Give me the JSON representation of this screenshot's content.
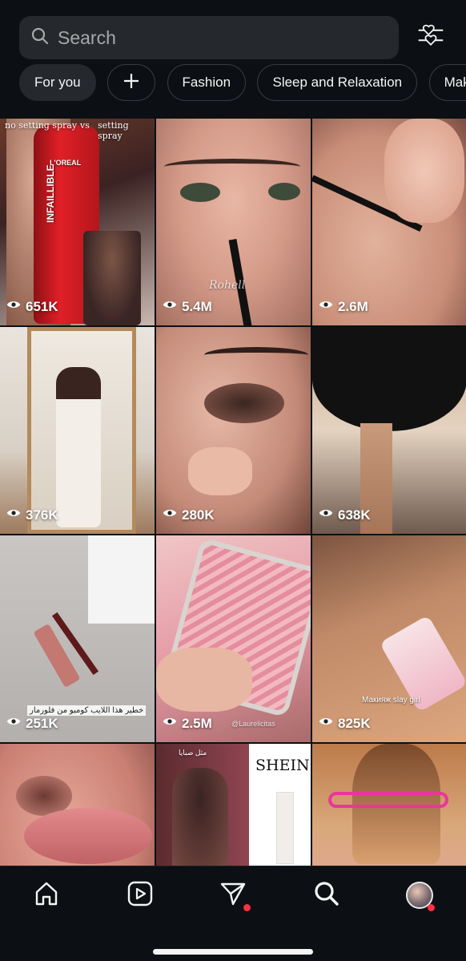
{
  "search": {
    "placeholder": "Search"
  },
  "chips": [
    {
      "label": "For you"
    },
    {
      "label": "+"
    },
    {
      "label": "Fashion"
    },
    {
      "label": "Sleep and Relaxation"
    },
    {
      "label": "Mak"
    }
  ],
  "grid": [
    {
      "views": "651K",
      "caption_left": "no setting spray",
      "caption_mid": "vs",
      "caption_right": "setting spray",
      "product_text": "INFAILLIBLE",
      "brand_text": "L'OREAL"
    },
    {
      "views": "5.4M",
      "signature": "Rohell"
    },
    {
      "views": "2.6M"
    },
    {
      "views": "376K"
    },
    {
      "views": "280K"
    },
    {
      "views": "638K"
    },
    {
      "views": "251K",
      "caption": "خطير هذا اللايب كومبو من فلورمار"
    },
    {
      "views": "2.5M",
      "caption": "@Laurelicitas"
    },
    {
      "views": "825K",
      "caption": "Макияж slay girl"
    },
    {
      "views": ""
    },
    {
      "views": "",
      "brand_text": "SHEIN",
      "caption": "مثل صبايا"
    },
    {
      "views": ""
    }
  ],
  "nav": {
    "items": [
      "home",
      "reels",
      "messages",
      "search",
      "profile"
    ]
  },
  "colors": {
    "background": "#0c1014",
    "accent_dot": "#ff3040",
    "chip_active": "#25292e"
  }
}
